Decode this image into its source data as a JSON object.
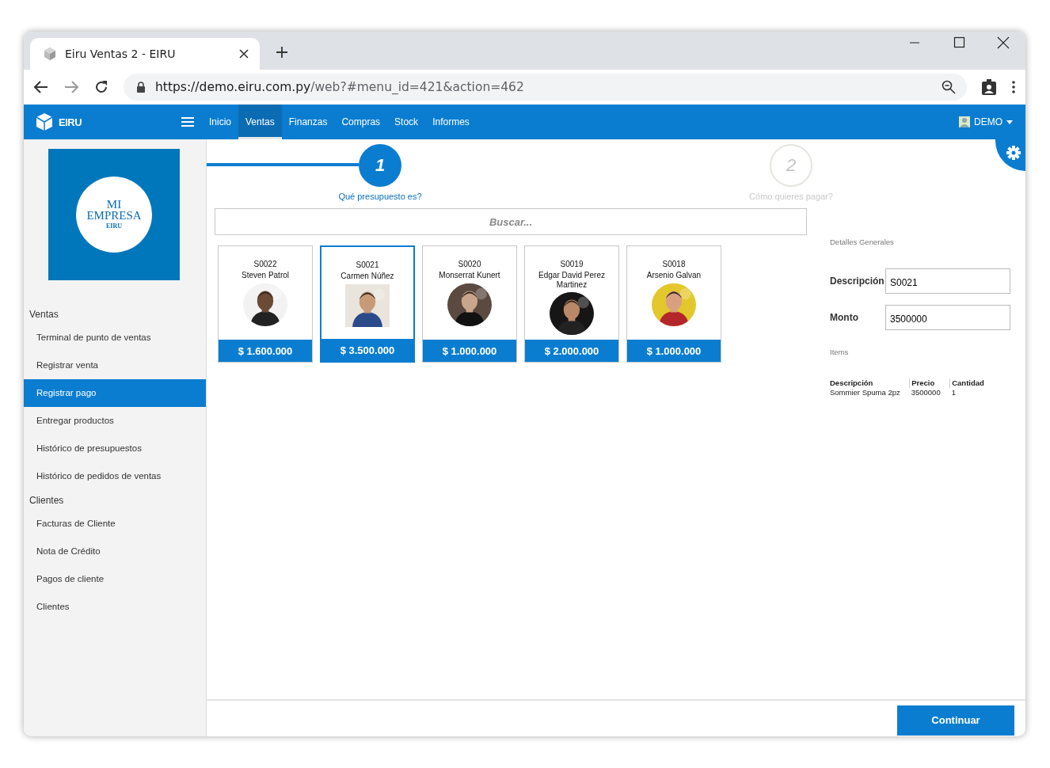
{
  "browser": {
    "tab_title": "Eiru Ventas 2 - EIRU",
    "url_host": "https://demo.eiru.com.py",
    "url_path": "/web?#menu_id=421&action=462"
  },
  "nav": {
    "brand": "EIRU",
    "items": [
      {
        "label": "Inicio",
        "selected": false
      },
      {
        "label": "Ventas",
        "selected": true
      },
      {
        "label": "Finanzas",
        "selected": false
      },
      {
        "label": "Compras",
        "selected": false
      },
      {
        "label": "Stock",
        "selected": false
      },
      {
        "label": "Informes",
        "selected": false
      }
    ],
    "user": "DEMO"
  },
  "sidebar": {
    "logo": {
      "line_1": "MI",
      "line_2": "EMPRESA",
      "line_3": "EIRU"
    },
    "groups": [
      {
        "title": "Ventas",
        "items": [
          {
            "label": "Terminal de punto de ventas",
            "selected": false
          },
          {
            "label": "Registrar venta",
            "selected": false
          },
          {
            "label": "Registrar pago",
            "selected": true
          },
          {
            "label": "Entregar productos",
            "selected": false
          },
          {
            "label": "Histórico de presupuestos",
            "selected": false
          },
          {
            "label": "Histórico de pedidos de ventas",
            "selected": false
          }
        ]
      },
      {
        "title": "Clientes",
        "items": [
          {
            "label": "Facturas de Cliente",
            "selected": false
          },
          {
            "label": "Nota de Crédito",
            "selected": false
          },
          {
            "label": "Pagos de cliente",
            "selected": false
          },
          {
            "label": "Clientes",
            "selected": false
          }
        ]
      }
    ]
  },
  "steps": [
    {
      "number": "1",
      "label": "Qué presupuesto es?",
      "selected": true
    },
    {
      "number": "2",
      "label": "Cómo quieres pagar?",
      "selected": false
    }
  ],
  "search": {
    "placeholder": "Buscar..."
  },
  "cards": [
    {
      "code": "S0022",
      "name": "Steven Patrol",
      "amount": "$ 1.600.000",
      "selected": false
    },
    {
      "code": "S0021",
      "name": "Carmen Núñez",
      "amount": "$ 3.500.000",
      "selected": true
    },
    {
      "code": "S0020",
      "name": "Monserrat Kunert",
      "amount": "$ 1.000.000",
      "selected": false
    },
    {
      "code": "S0019",
      "name": "Edgar David Perez Martinez",
      "amount": "$ 2.000.000",
      "selected": false
    },
    {
      "code": "S0018",
      "name": "Arsenio Galvan",
      "amount": "$ 1.000.000",
      "selected": false
    }
  ],
  "details": {
    "title": "Detalles Generales",
    "fields": [
      {
        "label": "Descripción",
        "value": "S0021"
      },
      {
        "label": "Monto",
        "value": "3500000"
      }
    ],
    "items_title": "Items",
    "table": {
      "columns": [
        "Descripción",
        "Precio",
        "Cantidad"
      ],
      "rows": [
        [
          "Sommier Spuma 2pz",
          "3500000",
          "1"
        ]
      ]
    }
  },
  "button": "Continuar"
}
